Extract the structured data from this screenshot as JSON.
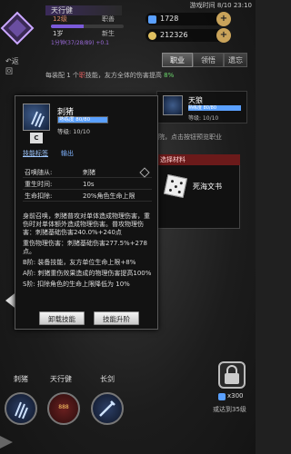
{
  "status_bar": {
    "time": "游戏时间 8/10 23:10"
  },
  "player": {
    "name": "天行健",
    "level": "12级",
    "title": "职善",
    "level2": "1岁",
    "stage": "新生",
    "exp_text": "1分钟(37/28/89) +0.1",
    "exp_fraction": 0.45
  },
  "resources": [
    {
      "name": "gem-blue",
      "value": "1728",
      "color": "#5aa0ff"
    },
    {
      "name": "coin",
      "value": "212326",
      "color": "#e0c060"
    }
  ],
  "nav": {
    "return_label": "返回"
  },
  "tabs": [
    {
      "label": "职业",
      "active": true
    },
    {
      "label": "领悟",
      "active": false
    },
    {
      "label": "遗忘",
      "active": false
    }
  ],
  "banner": {
    "prefix": "每装配 1 个",
    "highlight": "职",
    "middle": "技能，友方全体的伤害提高",
    "value": "8%"
  },
  "bg_job": {
    "name": "天狼",
    "bar_label": "熟练度 80/80",
    "level": "等级: 10/10",
    "hint": "院，点击按钮预览职业"
  },
  "materials": {
    "header": "选择材料",
    "item_name": "死海文书"
  },
  "popup": {
    "grade": "C",
    "title": "刺猪",
    "exp_label": "熟练度 80/80",
    "exp_fraction": 1.0,
    "level": "等级: 10/10",
    "tab_active": "技能标签",
    "tab_other": "输出",
    "stats": [
      {
        "k": "召唤随从:",
        "v": "刺猪"
      },
      {
        "k": "重生时间:",
        "v": "10s"
      },
      {
        "k": "生命扣除:",
        "v": "20%角色生命上限"
      }
    ],
    "description": [
      "身前召唤，刺猪普攻对单体造成物理伤害，重伤时对单体额外造成物理伤害。普攻物理伤害：刺猪基础伤害240.0%+240点",
      "重伤物理伤害：刺猪基础伤害277.5%+278点。",
      "B阶: 装备技能，友方单位生命上限+8%",
      "A阶: 刺猪重伤效果造成的物理伤害提高100%",
      "S阶: 扣除角色的生命上限降低为 10%"
    ],
    "btn_unload": "卸载技能",
    "btn_upgrade": "技能升阶"
  },
  "slots": [
    {
      "label": "刺猪"
    },
    {
      "label": "天行健"
    },
    {
      "label": "长剑"
    }
  ],
  "slot_badge": "888",
  "lock": {
    "cost": "x300",
    "unlock_text": "或达到35级"
  }
}
